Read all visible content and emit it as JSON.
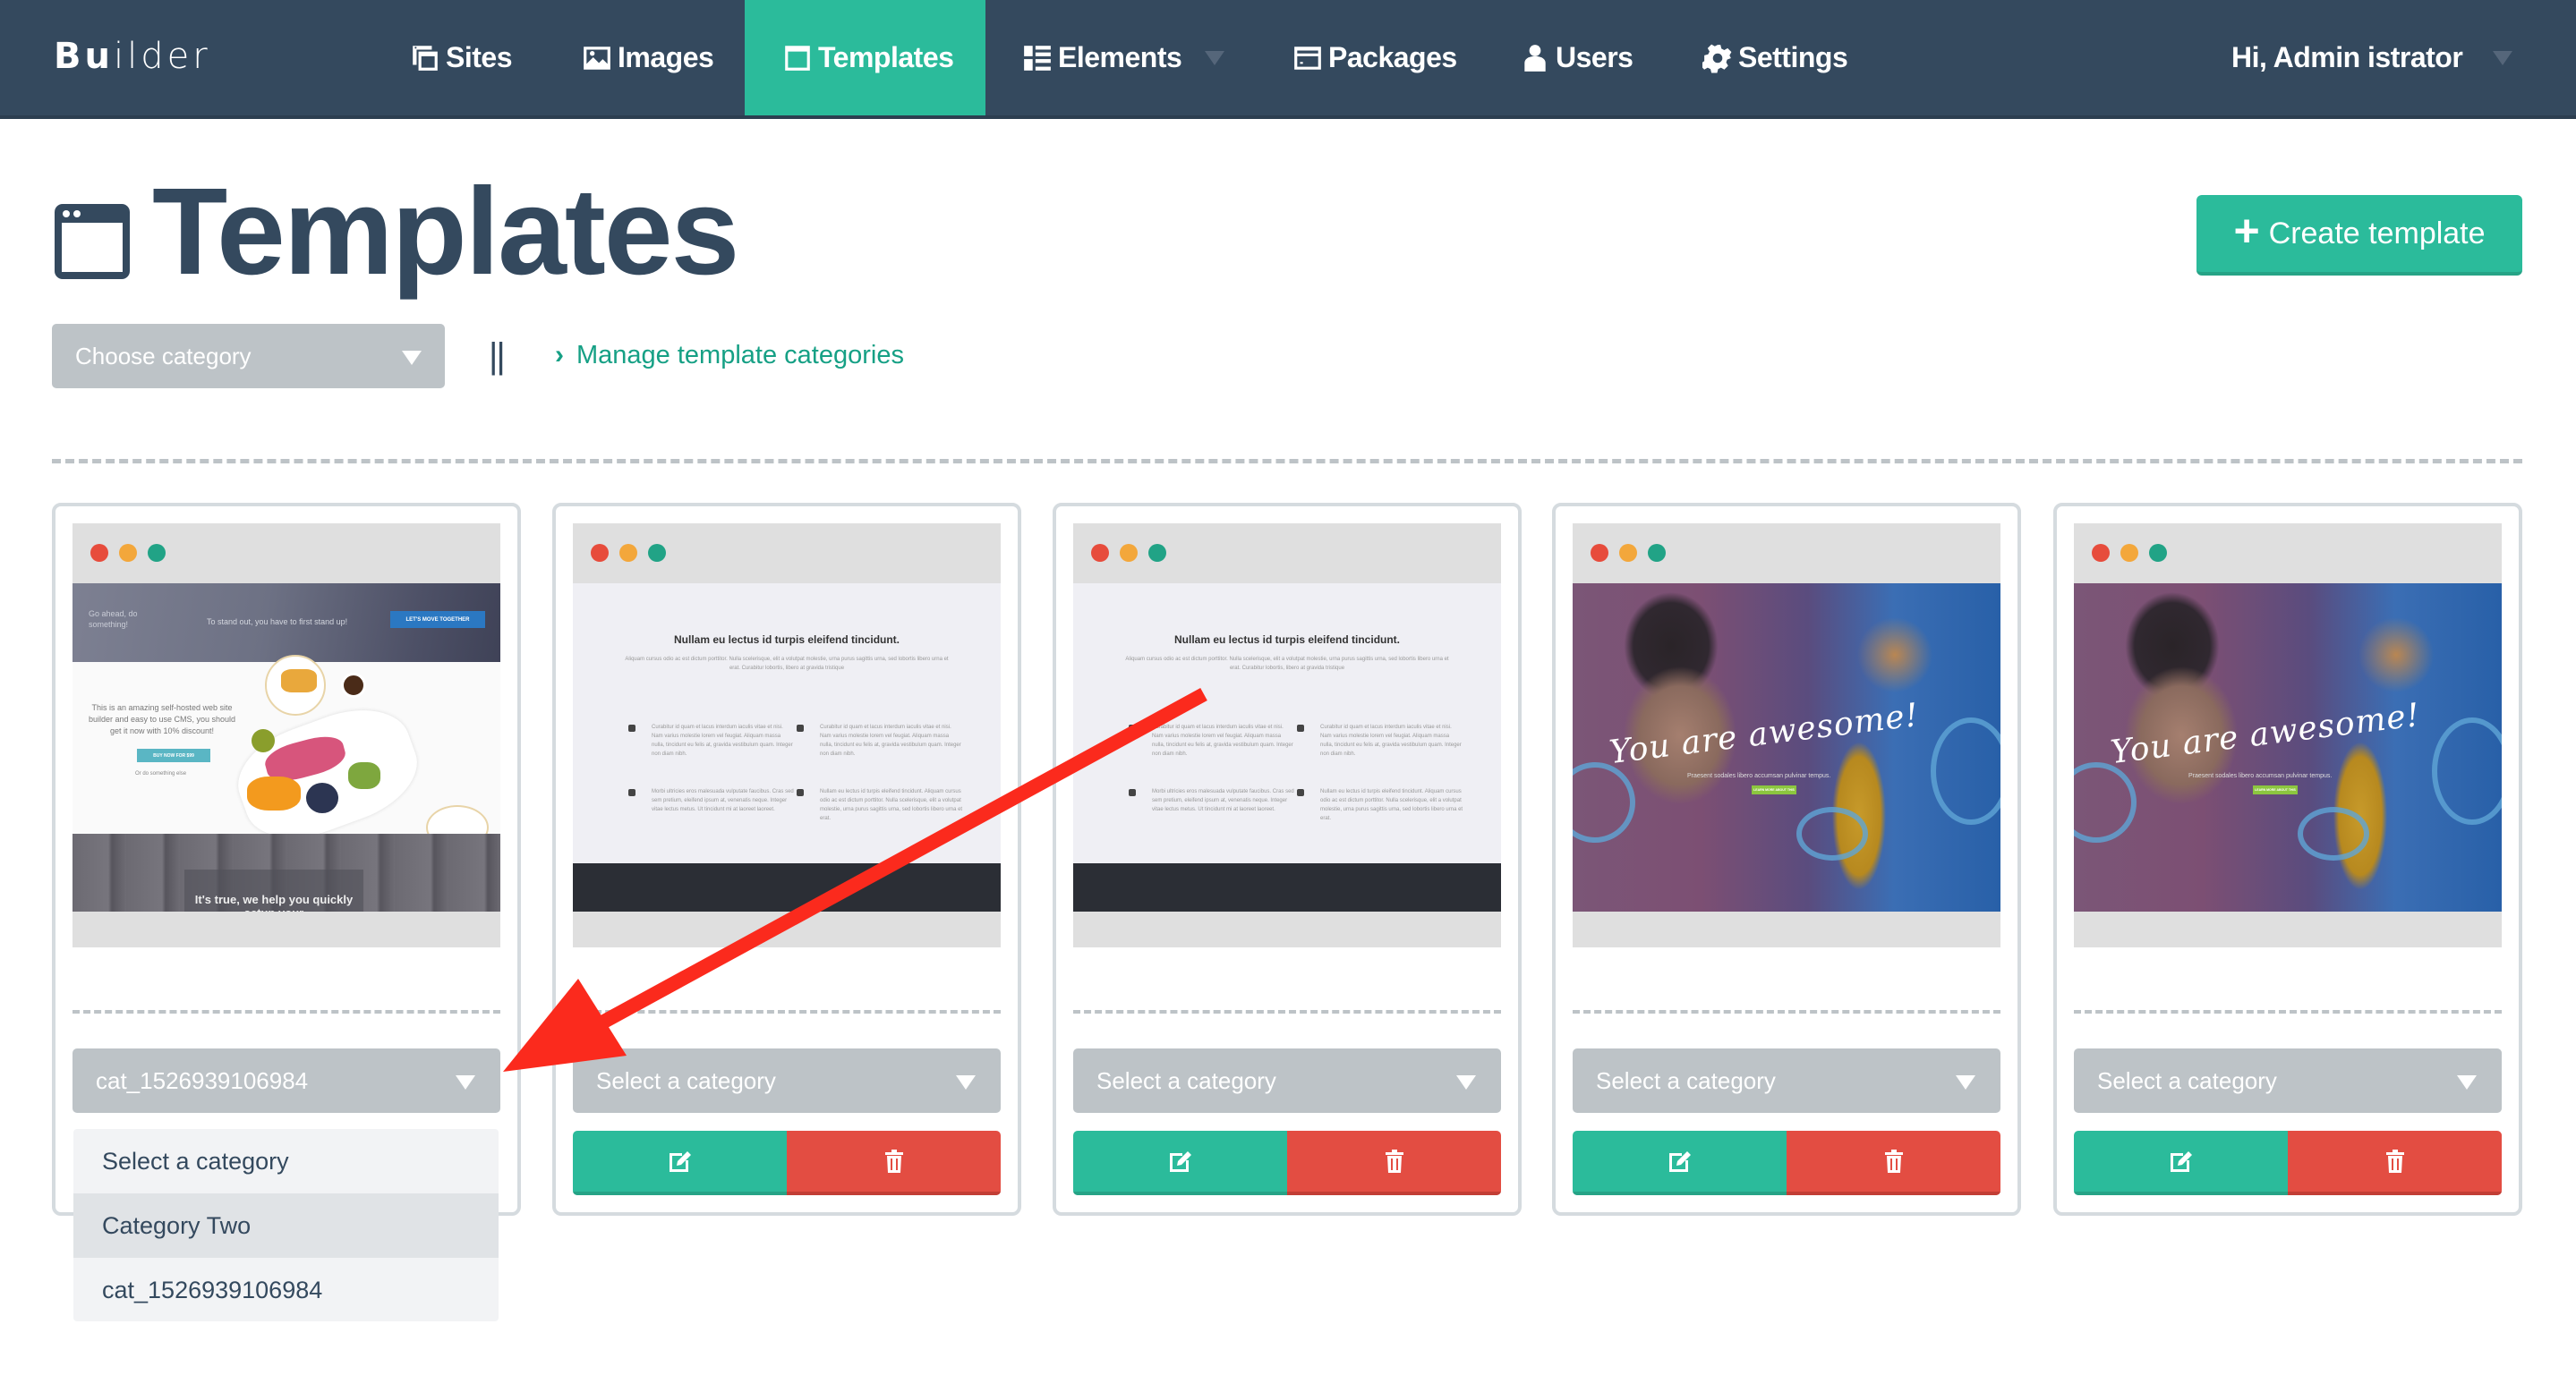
{
  "navbar": {
    "brand_bold": "Bu",
    "brand_rest": "ilder",
    "items": [
      {
        "label": "Sites",
        "icon": "sites-icon"
      },
      {
        "label": "Images",
        "icon": "image-icon"
      },
      {
        "label": "Templates",
        "icon": "window-icon",
        "active": true
      },
      {
        "label": "Elements",
        "icon": "list-icon",
        "has_dropdown": true
      },
      {
        "label": "Packages",
        "icon": "package-icon"
      },
      {
        "label": "Users",
        "icon": "user-icon"
      },
      {
        "label": "Settings",
        "icon": "gear-icon"
      }
    ],
    "user_greeting": "Hi, Admin istrator"
  },
  "header": {
    "title": "Templates",
    "create_button": "Create template",
    "category_filter_placeholder": "Choose category",
    "separator": "||",
    "manage_link": "Manage template categories"
  },
  "colors": {
    "navbar": "#34495e",
    "accent": "#2bbb9b",
    "danger": "#e34d42",
    "link": "#16a085",
    "select_bg": "#bdc3c7"
  },
  "templates": [
    {
      "category": "cat_1526939106984",
      "preview": {
        "top_left_text": "Go ahead, do something!",
        "top_center_text": "To stand out, you have to first stand up!",
        "top_button": "LET'S MOVE TOGETHER",
        "body_text": "This is an amazing self-hosted web site builder and easy to use CMS, you should get it now with 10% discount!",
        "buy_button": "BUY NOW FOR $99",
        "or_text": "Or do something else",
        "bottom_text": "It's true, we help you quickly setup your"
      }
    },
    {
      "category": "Select a category",
      "preview": {
        "heading": "Nullam eu lectus id turpis eleifend tincidunt.",
        "paragraph": "Aliquam cursus odio ac est dictum porttitor. Nulla scelerisque, elit a volutpat molestie, urna purus sagittis urna, sed lobortis libero urna et erat. Curabitur lobortis, libero at gravida tristique",
        "features": [
          "Curabitur id quam et lacus interdum iaculis vitae et nisi. Nam varius molestie lorem vel feugiat. Aliquam massa nulla, tincidunt eu felis at, gravida vestibulum quam. Integer non diam nibh.",
          "Curabitur id quam et lacus interdum iaculis vitae et nisi. Nam varius molestie lorem vel feugiat. Aliquam massa nulla, tincidunt eu felis at, gravida vestibulum quam. Integer non diam nibh.",
          "Morbi ultricies eros malesuada vulputate faucibus. Cras sed sem pretium, eleifend ipsum at, venenatis neque. Integer vitae lectus metus. Ut tincidunt mi at laoreet laoreet.",
          "Nullam eu lectus id turpis eleifend tincidunt. Aliquam cursus odio ac est dictum porttitor. Nulla scelerisque, elit a volutpat molestie, urna purus sagittis urna, sed lobortis libero urna et erat."
        ]
      }
    },
    {
      "category": "Select a category",
      "preview": {
        "heading": "Nullam eu lectus id turpis eleifend tincidunt.",
        "paragraph": "Aliquam cursus odio ac est dictum porttitor. Nulla scelerisque, elit a volutpat molestie, urna purus sagittis urna, sed lobortis libero urna et erat. Curabitur lobortis, libero at gravida tristique",
        "features": [
          "Curabitur id quam et lacus interdum iaculis vitae et nisi. Nam varius molestie lorem vel feugiat. Aliquam massa nulla, tincidunt eu felis at, gravida vestibulum quam. Integer non diam nibh.",
          "Curabitur id quam et lacus interdum iaculis vitae et nisi. Nam varius molestie lorem vel feugiat. Aliquam massa nulla, tincidunt eu felis at, gravida vestibulum quam. Integer non diam nibh.",
          "Morbi ultricies eros malesuada vulputate faucibus. Cras sed sem pretium, eleifend ipsum at, venenatis neque. Integer vitae lectus metus. Ut tincidunt mi at laoreet laoreet.",
          "Nullam eu lectus id turpis eleifend tincidunt. Aliquam cursus odio ac est dictum porttitor. Nulla scelerisque, elit a volutpat molestie, urna purus sagittis urna, sed lobortis libero urna et erat."
        ]
      }
    },
    {
      "category": "Select a category",
      "preview": {
        "headline": "You are awesome!",
        "subtext": "Praesent sodales libero accumsan pulvinar tempus.",
        "button": "LEARN MORE ABOUT THIS"
      }
    },
    {
      "category": "Select a category",
      "preview": {
        "headline": "You are awesome!",
        "subtext": "Praesent sodales libero accumsan pulvinar tempus.",
        "button": "LEARN MORE ABOUT THIS"
      }
    }
  ],
  "open_dropdown": {
    "options": [
      "Select a category",
      "Category Two",
      "cat_1526939106984"
    ],
    "highlighted": "Category Two"
  }
}
